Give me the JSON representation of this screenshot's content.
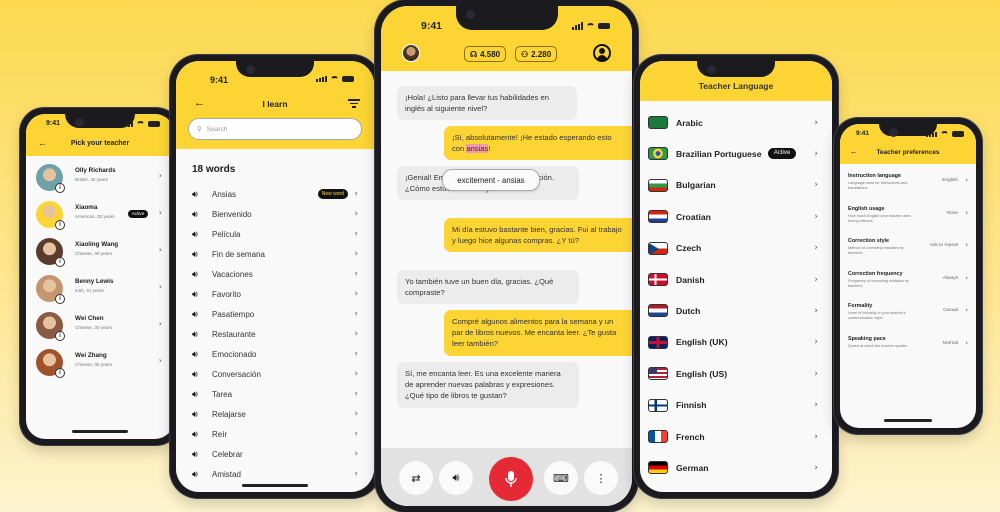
{
  "status_time": "9:41",
  "teacher_picker": {
    "title": "Pick your teacher",
    "active_badge": "Active",
    "teachers": [
      {
        "name": "Olly Richards",
        "info": "British, 42 years",
        "avatar_color": "#6fa1a6"
      },
      {
        "name": "Xiaoma",
        "info": "American, 33 years",
        "avatar_color": "#fcd535",
        "active": true
      },
      {
        "name": "Xiaoling Wang",
        "info": "Chinese, 30 years",
        "avatar_color": "#5a3b2c"
      },
      {
        "name": "Benny Lewis",
        "info": "Irish, 41 years",
        "avatar_color": "#c49670"
      },
      {
        "name": "Wei Chen",
        "info": "Chinese, 30 years",
        "avatar_color": "#8a5a44"
      },
      {
        "name": "Wei Zhang",
        "info": "Chinese, 35 years",
        "avatar_color": "#a0522d"
      }
    ]
  },
  "vocab": {
    "title": "I learn",
    "search_placeholder": "Search",
    "count_label": "18 words",
    "new_badge": "New word",
    "words": [
      "Ansias",
      "Bienvenido",
      "Película",
      "Fin de semana",
      "Vacaciones",
      "Favorito",
      "Pasatiempo",
      "Restaurante",
      "Emocionado",
      "Conversación",
      "Tarea",
      "Relajarse",
      "Reír",
      "Celebrar",
      "Amistad"
    ]
  },
  "chat": {
    "coins": "4.580",
    "friends": "2.280",
    "tooltip": "excitement - ansias",
    "highlight_word": "ansias",
    "messages": [
      {
        "side": "l",
        "text": "¡Hola! ¿Listo para llevar tus habilidades en inglés al siguiente nivel?"
      },
      {
        "side": "r",
        "pre": "¡Sí, absolutamente! ¡He estado esperando esto con ",
        "post": "!"
      },
      {
        "side": "l",
        "text": "¡Genial! Empecemos con una conversación. ¿Cómo estuvo tu día hoy?"
      },
      {
        "side": "r",
        "text": "Mi día estuvo bastante bien, gracias. Fui al trabajo y luego hice algunas compras. ¿Y tú?"
      },
      {
        "side": "l",
        "text": "Yo también tuve un buen día, gracias. ¿Qué compraste?"
      },
      {
        "side": "r",
        "text": "Compré algunos alimentos para la semana y un par de libros nuevos. Me encanta leer. ¿Te gusta leer también?"
      },
      {
        "side": "l",
        "text": "Sí, me encanta leer. Es una excelente manera de aprender nuevas palabras y expresiones. ¿Qué tipo de libros te gustan?"
      }
    ],
    "mic_color": "#e52935"
  },
  "languages": {
    "title": "Teacher Language",
    "active_badge": "Active",
    "items": [
      {
        "name": "Arabic",
        "flag": "sa"
      },
      {
        "name": "Brazilian Portuguese",
        "flag": "br",
        "active": true
      },
      {
        "name": "Bulgarian",
        "flag": "bg"
      },
      {
        "name": "Croatian",
        "flag": "hr"
      },
      {
        "name": "Czech",
        "flag": "cz"
      },
      {
        "name": "Danish",
        "flag": "dk"
      },
      {
        "name": "Dutch",
        "flag": "nl"
      },
      {
        "name": "English (UK)",
        "flag": "gb"
      },
      {
        "name": "English (US)",
        "flag": "us"
      },
      {
        "name": "Finnish",
        "flag": "fi"
      },
      {
        "name": "French",
        "flag": "fr"
      },
      {
        "name": "German",
        "flag": "de"
      }
    ]
  },
  "preferences": {
    "title": "Teacher preferences",
    "items": [
      {
        "title": "Instruction language",
        "desc": "Language used for instructions and translations",
        "value": "English"
      },
      {
        "title": "English usage",
        "desc": "How much English your teacher uses during lessons.",
        "value": "None"
      },
      {
        "title": "Correction style",
        "desc": "Method of correcting mistakes by teachers",
        "value": "Ask to repeat"
      },
      {
        "title": "Correction frequency",
        "desc": "Frequency of correcting mistakes by teachers",
        "value": "Always"
      },
      {
        "title": "Formality",
        "desc": "Level of formality in your teacher's communication style.",
        "value": "Casual"
      },
      {
        "title": "Speaking pace",
        "desc": "Speed at which the teacher speaks",
        "value": "Normal"
      }
    ]
  },
  "brand_yellow": "#fcd535"
}
